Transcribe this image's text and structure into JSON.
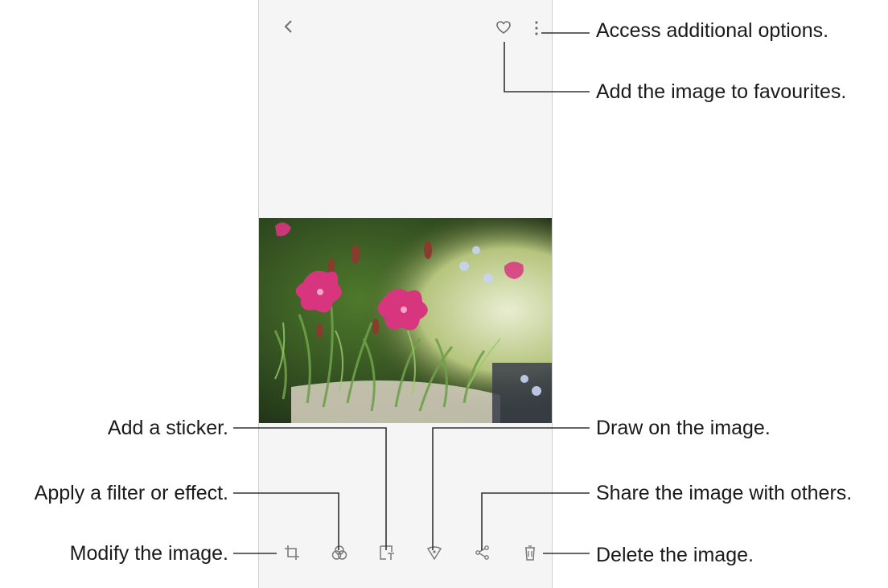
{
  "callouts": {
    "more_options": "Access additional options.",
    "favourites": "Add the image to favourites.",
    "sticker": "Add a sticker.",
    "draw": "Draw on the image.",
    "filter": "Apply a filter or effect.",
    "share": "Share the image with others.",
    "modify": "Modify the image.",
    "delete": "Delete the image."
  },
  "icons": {
    "back": "chevron-left-icon",
    "favourite": "heart-icon",
    "more": "more-vertical-icon",
    "edit": "crop-icon",
    "filter": "filter-icon",
    "sticker": "sticker-icon",
    "draw": "pen-icon",
    "share": "share-icon",
    "delete": "trash-icon"
  },
  "colors": {
    "line": "#333333",
    "icon": "#7a7a7a",
    "flower": "#d8357f"
  }
}
